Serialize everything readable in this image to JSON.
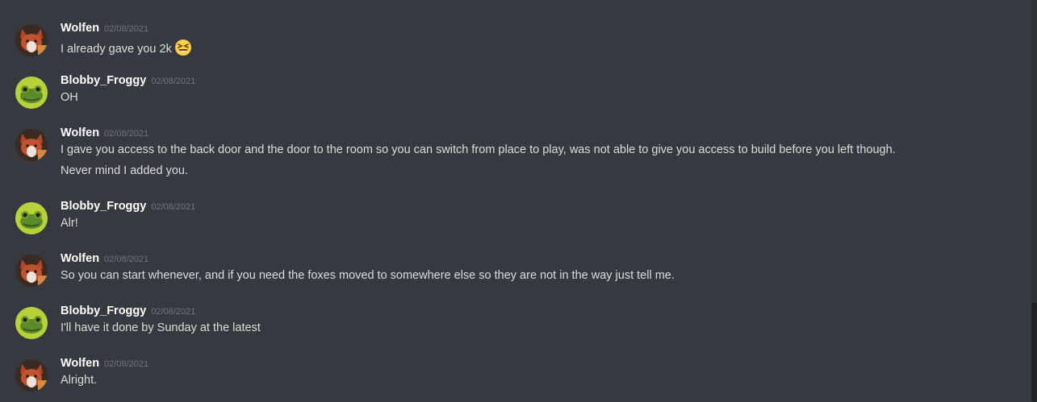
{
  "messages": [
    {
      "user": "Wolfen",
      "avatar": "fox-avatar",
      "time": "02/08/2021",
      "lines": [
        "I already gave you 2k"
      ],
      "emoji": "laughing-emoji"
    },
    {
      "user": "Blobby_Froggy",
      "avatar": "frog-avatar",
      "time": "02/08/2021",
      "lines": [
        "OH"
      ]
    },
    {
      "user": "Wolfen",
      "avatar": "fox-avatar",
      "time": "02/08/2021",
      "lines": [
        "I gave you access to the back door and the door to the room so you can switch from place to play, was not able to give you access to build before you left though.",
        "Never mind I added you."
      ]
    },
    {
      "user": "Blobby_Froggy",
      "avatar": "frog-avatar",
      "time": "02/08/2021",
      "lines": [
        "Alr!"
      ]
    },
    {
      "user": "Wolfen",
      "avatar": "fox-avatar",
      "time": "02/08/2021",
      "lines": [
        "So you can start whenever, and if you need the foxes moved to somewhere else so they are not in the way just tell me."
      ]
    },
    {
      "user": "Blobby_Froggy",
      "avatar": "frog-avatar",
      "time": "02/08/2021",
      "lines": [
        "I'll have it done by Sunday at the latest"
      ]
    },
    {
      "user": "Wolfen",
      "avatar": "fox-avatar",
      "time": "02/08/2021",
      "lines": [
        "Alright."
      ]
    }
  ],
  "colors": {
    "background": "#36393f",
    "username": "#ffffff",
    "timestamp": "#72767d",
    "text": "#dcddde"
  }
}
